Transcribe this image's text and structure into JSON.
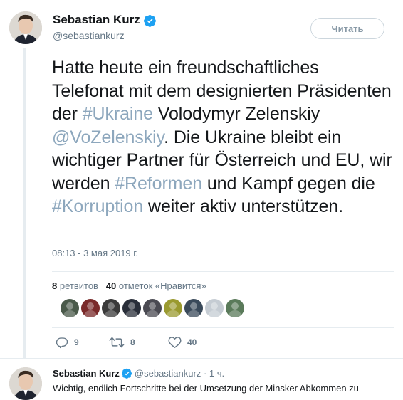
{
  "author": {
    "name": "Sebastian Kurz",
    "handle": "@sebastiankurz",
    "verified": true
  },
  "follow_button": {
    "label": "Читать"
  },
  "tweet": {
    "segments": [
      {
        "text": "Hatte heute ein freundschaftliches Telefonat mit dem designierten Präsidenten der ",
        "link": false
      },
      {
        "text": "#Ukraine",
        "link": true
      },
      {
        "text": " Volodymyr Zelenskiy ",
        "link": false
      },
      {
        "text": "@VoZelenskiy",
        "link": true
      },
      {
        "text": ". Die Ukraine bleibt ein wichtiger Partner für Österreich und EU, wir werden ",
        "link": false
      },
      {
        "text": "#Reformen",
        "link": true
      },
      {
        "text": " und Kampf gegen die ",
        "link": false
      },
      {
        "text": "#Korruption",
        "link": true
      },
      {
        "text": " weiter aktiv unterstützen.",
        "link": false
      }
    ],
    "timestamp": "08:13 - 3 мая 2019 г."
  },
  "stats": {
    "retweets_count": "8",
    "retweets_label": "ретвитов",
    "likes_count": "40",
    "likes_label": "отметок «Нравится»"
  },
  "likers": [
    {
      "name": "liker-1",
      "color": "#4a5a4a"
    },
    {
      "name": "liker-2",
      "color": "#7a2a2a"
    },
    {
      "name": "liker-3",
      "color": "#3a3a3a"
    },
    {
      "name": "liker-4",
      "color": "#2a2f3a"
    },
    {
      "name": "liker-5",
      "color": "#4a4a52"
    },
    {
      "name": "liker-6",
      "color": "#9a9a30"
    },
    {
      "name": "liker-7",
      "color": "#3a4a5a"
    },
    {
      "name": "liker-8",
      "color": "#c5ccd3"
    },
    {
      "name": "liker-9",
      "color": "#5a7a5a"
    }
  ],
  "actions": {
    "reply": {
      "icon": "reply-icon",
      "count": "9"
    },
    "retweet": {
      "icon": "retweet-icon",
      "count": "8"
    },
    "like": {
      "icon": "heart-icon",
      "count": "40"
    }
  },
  "reply_tweet": {
    "name": "Sebastian Kurz",
    "handle": "@sebastiankurz",
    "time": "· 1 ч.",
    "text": "Wichtig, endlich Fortschritte bei der Umsetzung der Minsker Abkommen zu"
  },
  "colors": {
    "link": "#8da7bd",
    "verified": "#1da1f2",
    "muted": "#657786"
  }
}
